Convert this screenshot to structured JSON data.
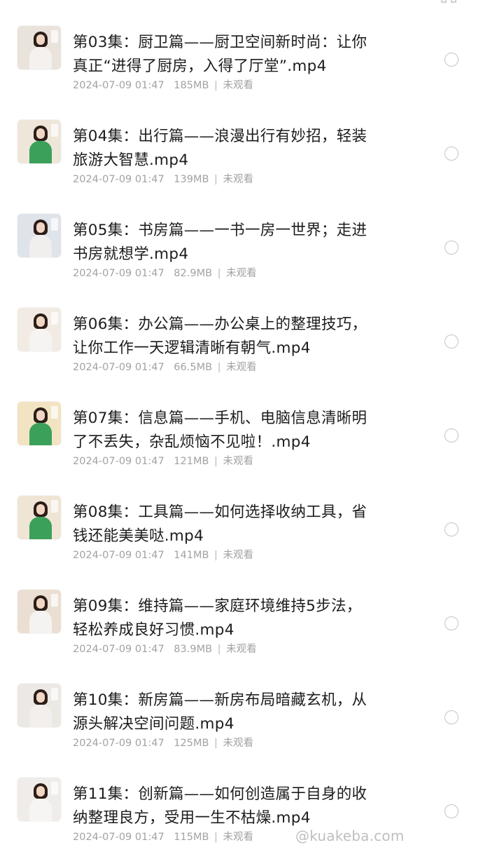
{
  "items": [
    {
      "title_line1": "第03集：厨卫篇——厨卫空间新时尚：让你",
      "title_line2": "真正“进得了厨房，入得了厅堂”.mp4",
      "date": "2024-07-09 01:47",
      "size": "185MB",
      "status": "未观看",
      "thumb_bg": "#e9e3dc",
      "thumb_shirt": "#f4f1ee"
    },
    {
      "title_line1": "第04集：出行篇——浪漫出行有妙招，轻装",
      "title_line2": "旅游大智慧.mp4",
      "date": "2024-07-09 01:47",
      "size": "139MB",
      "status": "未观看",
      "thumb_bg": "#efe6da",
      "thumb_shirt": "#3aa05a"
    },
    {
      "title_line1": "第05集：书房篇——一书一房一世界；走进",
      "title_line2": "书房就想学.mp4",
      "date": "2024-07-09 01:47",
      "size": "82.9MB",
      "status": "未观看",
      "thumb_bg": "#dfe3ea",
      "thumb_shirt": "#f1eeee"
    },
    {
      "title_line1": "第06集：办公篇——办公桌上的整理技巧，",
      "title_line2": "让你工作一天逻辑清晰有朝气.mp4",
      "date": "2024-07-09 01:47",
      "size": "66.5MB",
      "status": "未观看",
      "thumb_bg": "#f1ebe3",
      "thumb_shirt": "#f6f4f2"
    },
    {
      "title_line1": "第07集：信息篇——手机、电脑信息清晰明",
      "title_line2": "了不丢失，杂乱烦恼不见啦！.mp4",
      "date": "2024-07-09 01:47",
      "size": "121MB",
      "status": "未观看",
      "thumb_bg": "#f2e3c2",
      "thumb_shirt": "#3aa05a"
    },
    {
      "title_line1": "第08集：工具篇——如何选择收纳工具，省",
      "title_line2": "钱还能美美哒.mp4",
      "date": "2024-07-09 01:47",
      "size": "141MB",
      "status": "未观看",
      "thumb_bg": "#efe5d5",
      "thumb_shirt": "#3aa05a"
    },
    {
      "title_line1": "第09集：维持篇——家庭环境维持5步法，",
      "title_line2": "轻松养成良好习惯.mp4",
      "date": "2024-07-09 01:47",
      "size": "83.9MB",
      "status": "未观看",
      "thumb_bg": "#eadfd2",
      "thumb_shirt": "#f5f3f1"
    },
    {
      "title_line1": "第10集：新房篇——新房布局暗藏玄机，从",
      "title_line2": "源头解决空间问题.mp4",
      "date": "2024-07-09 01:47",
      "size": "125MB",
      "status": "未观看",
      "thumb_bg": "#ece8e4",
      "thumb_shirt": "#f3efec"
    },
    {
      "title_line1": "第11集：创新篇——如何创造属于自身的收",
      "title_line2": "纳整理良方，受用一生不枯燥.mp4",
      "date": "2024-07-09 01:47",
      "size": "115MB",
      "status": "未观看",
      "thumb_bg": "#f0ecea",
      "thumb_shirt": "#f7f5f3"
    }
  ],
  "watermark": "@kuakeba.com",
  "colors": {
    "title": "#1c1c1c",
    "meta": "#a2a2a2",
    "radio_border": "#c4c4c4"
  }
}
